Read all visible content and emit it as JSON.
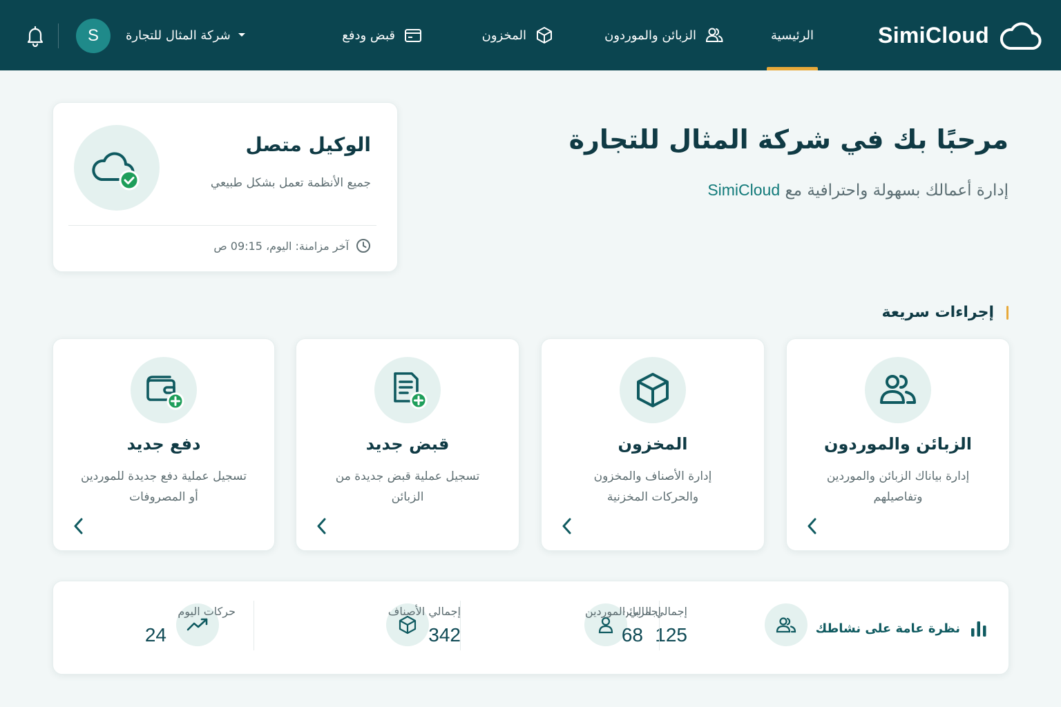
{
  "app": {
    "brand": "SimiCloud"
  },
  "nav": {
    "items": [
      {
        "label": "الرئيسية",
        "active": true
      },
      {
        "label": "الزبائن والموردون",
        "icon": "users-icon"
      },
      {
        "label": "المخزون",
        "icon": "box-icon"
      },
      {
        "label": "قبض ودفع",
        "icon": "wallet-icon"
      }
    ],
    "company": "شركة المثال للتجارة",
    "avatar_letter": "S"
  },
  "welcome": {
    "title": "مرحبًا بك في شركة المثال للتجارة",
    "subtitle_prefix": "إدارة أعمالك بسهولة واحترافية مع",
    "subtitle_brand": "SimiCloud"
  },
  "agent": {
    "title": "الوكيل متصل",
    "status": "جميع الأنظمة تعمل بشكل طبيعي",
    "last_sync": "آخر مزامنة: اليوم، 09:15 ص"
  },
  "quick_actions": {
    "title": "إجراءات سريعة",
    "items": [
      {
        "title": "الزبائن والموردون",
        "desc": "إدارة بياناك الزبائن والموردين وتفاصيلهم",
        "icon": "users-icon"
      },
      {
        "title": "المخزون",
        "desc": "إدارة الأصناف والمخزون والحركات المخزنية",
        "icon": "box-icon"
      },
      {
        "title": "قبض جديد",
        "desc": "تسجيل عملية قبض جديدة من الزبائن",
        "icon": "receipt-add-icon"
      },
      {
        "title": "دفع جديد",
        "desc": "تسجيل عملية دفع جديدة للموردين أو المصروفات",
        "icon": "wallet-add-icon"
      }
    ]
  },
  "stats": {
    "title": "نظرة عامة على نشاطك",
    "items": [
      {
        "label": "إجمالي الزبائن",
        "value": "125",
        "icon": "users-icon"
      },
      {
        "label": "إجمالي الموردين",
        "value": "68",
        "icon": "user-icon"
      },
      {
        "label": "إجمالي الأصناف",
        "value": "342",
        "icon": "box-icon"
      },
      {
        "label": "حركات اليوم",
        "value": "24",
        "icon": "trend-icon"
      }
    ]
  },
  "colors": {
    "topbar": "#0b4550",
    "accent": "#e8a93a",
    "teal": "#127a7a",
    "success": "#1e9e5a"
  }
}
